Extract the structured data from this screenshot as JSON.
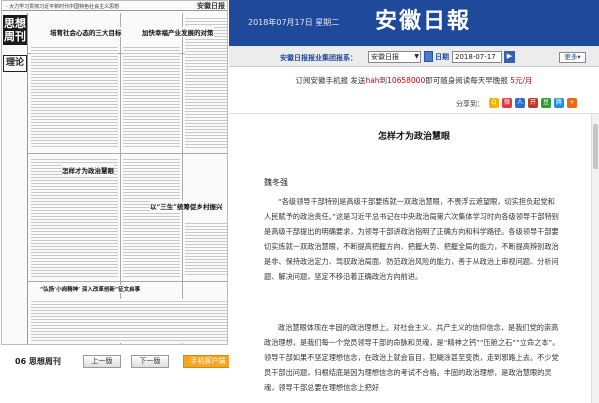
{
  "newspaper": {
    "masthead_strip": "· 大力学习贯彻习近平新时代中国特色社会主义思想",
    "masthead_logo": "安徽日报",
    "side_title": "思想周刊",
    "side_title2": "理论",
    "headlines": [
      "培育社会心态的三大目标",
      "加快幸福产业发展的对策",
      "怎样才为政治慧眼",
      "以“三生”统筹促乡村振兴",
      "“弘扬‘小岗精神’ 深入改革创新”征文启事"
    ]
  },
  "pager": {
    "page_label": "06 思想周刊",
    "prev": "上一版",
    "next": "下一版",
    "app": "手机客户端"
  },
  "header": {
    "date": "2018年07月17日 星期二",
    "logo": "安徽日報"
  },
  "toolbar": {
    "group_link": "安徽日报报业集团报系：",
    "paper_select": "安徽日报",
    "date_label": "日期",
    "date_value": "2018-07-17",
    "go": "▶",
    "more": "更多▾"
  },
  "promo": {
    "prefix": "订阅安徽手机报  发送",
    "keyword": "hah",
    "mid": "到",
    "number": "10658000",
    "suffix": "即可随身阅读每天早晚报  ",
    "price": "5元/月"
  },
  "share": {
    "label": "分享到：",
    "icons": [
      {
        "name": "qzone-icon",
        "color": "#f4b400",
        "glyph": "Q"
      },
      {
        "name": "weibo-icon",
        "color": "#e0383e",
        "glyph": "微"
      },
      {
        "name": "renren-icon",
        "color": "#2f6bd1",
        "glyph": "人"
      },
      {
        "name": "kaixin-icon",
        "color": "#c03a2b",
        "glyph": "开"
      },
      {
        "name": "douban-icon",
        "color": "#2e9b3a",
        "glyph": "豆"
      },
      {
        "name": "tencent-weibo-icon",
        "color": "#1f8fd6",
        "glyph": "腾"
      },
      {
        "name": "more-share-icon",
        "color": "#e86a10",
        "glyph": "+"
      }
    ]
  },
  "article": {
    "title": "怎样才为政治慧眼",
    "author": "魏冬强",
    "paragraphs": [
      "“各级领导干部特别是高级干部要炼就一双政治慧眼，不畏浮云遮望眼，切实担负起党和人民赋予的政治责任。”这是习近平总书记在中央政治局第六次集体学习时向各级领导干部特别是高级干部提出的明确要求，为领导干部讲政治指明了正确方向和科学路径。各级领导干部要切实炼就一双政治慧眼，不断提高把握方向、把握大势、把握全局的能力，不断提高辨别政治是非、保持政治定力、驾驭政治局面、防范政治风险的能力，善于从政治上审视问题、分析问题、解决问题，坚定不移沿着正确政治方向前进。",
      "政治慧眼体现在丰固的政治理想上。对社会主义、共产主义的信仰信念，是我们党的崇高政治理想，是我们每一个党员领导干部的命脉和灵魂，是“精神之钙”“压舱之石”“立命之本”。领导干部如果不坚定理想信念，在政治上就会盲目，犯糊涂甚至变质，走到邪路上去。不少党员干部出问题，归根结底是因为理想信念的考试不合格。丰固的政治理想，是政治慧眼的灵魂，领导干部总要在理想信念上把好"
    ]
  }
}
